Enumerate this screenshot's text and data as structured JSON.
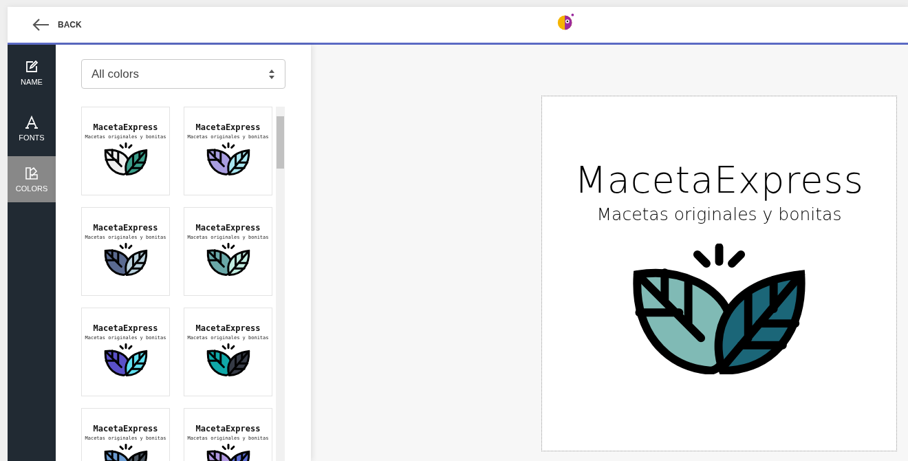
{
  "topbar": {
    "back_label": "BACK"
  },
  "sidebar": {
    "items": [
      {
        "kind": "name",
        "label": "NAME",
        "selected": false
      },
      {
        "kind": "fonts",
        "label": "FONTS",
        "selected": false
      },
      {
        "kind": "colors",
        "label": "COLORS",
        "selected": true
      }
    ]
  },
  "filter": {
    "value": "All colors"
  },
  "palettes": [
    {
      "title": "MacetaExpress",
      "tagline": "Macetas originales y bonitas",
      "leaves": [
        {
          "color": "#f0f0f0"
        },
        {
          "color": "#3a9e8a"
        }
      ]
    },
    {
      "title": "MacetaExpress",
      "tagline": "Macetas originales y bonitas",
      "leaves": [
        {
          "color": "#a99ee0"
        },
        {
          "color": "#a8e6f0"
        }
      ]
    },
    {
      "title": "MacetaExpress",
      "tagline": "Macetas originales y bonitas",
      "leaves": [
        {
          "color": "#5a6a90"
        },
        {
          "color": "#b8d0dc"
        }
      ]
    },
    {
      "title": "MacetaExpress",
      "tagline": "Macetas originales y bonitas",
      "leaves": [
        {
          "color": "#6aa8a8"
        },
        {
          "color": "#c0ece0"
        }
      ]
    },
    {
      "title": "MacetaExpress",
      "tagline": "Macetas originales y bonitas",
      "leaves": [
        {
          "color": "#5a50c8"
        },
        {
          "color": "#60e0f0"
        }
      ]
    },
    {
      "title": "MacetaExpress",
      "tagline": "Macetas originales y bonitas",
      "leaves": [
        {
          "color": "#10a8a8"
        },
        {
          "color": "#353a45"
        }
      ]
    },
    {
      "title": "MacetaExpress",
      "tagline": "Macetas originales y bonitas",
      "leaves": [
        {
          "color": "#6a9ad0"
        },
        {
          "color": "#4a5560"
        }
      ]
    },
    {
      "title": "MacetaExpress",
      "tagline": "Macetas originales y bonitas",
      "leaves": [
        {
          "color": "#b098e0"
        },
        {
          "color": "#5a6ad0"
        }
      ]
    }
  ],
  "preview": {
    "title": "MacetaExpress",
    "tagline": "Macetas originales y bonitas",
    "leaves": [
      {
        "color": "#80bab5"
      },
      {
        "color": "#1b6678"
      }
    ]
  }
}
